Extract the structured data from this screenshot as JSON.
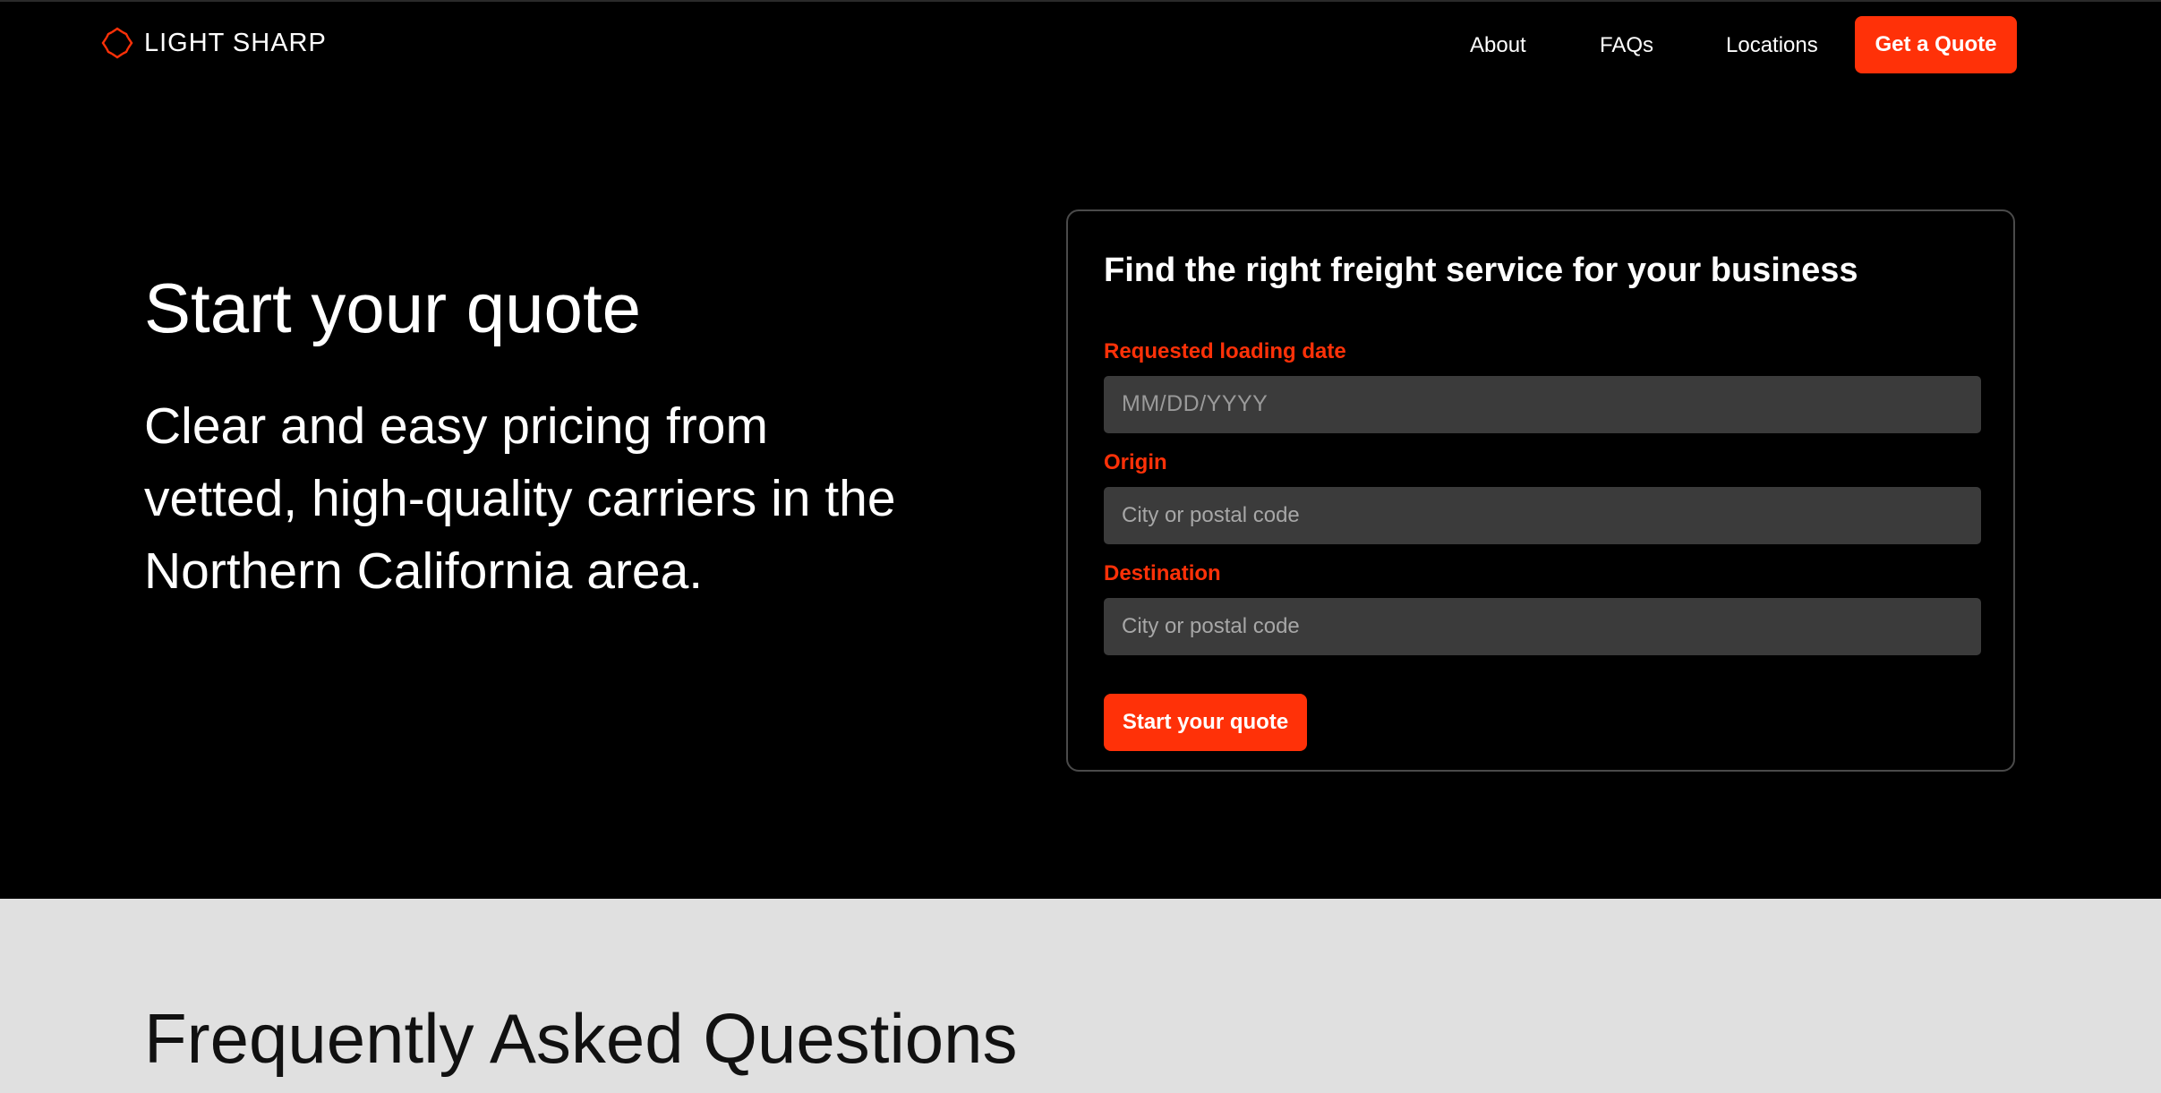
{
  "brand": {
    "name": "LIGHT SHARP",
    "logo_icon": "burst-logo-icon",
    "accent_color": "#ff3108"
  },
  "nav": {
    "about": "About",
    "faqs": "FAQs",
    "locations": "Locations",
    "cta": "Get a Quote"
  },
  "hero": {
    "title": "Start your quote",
    "subtitle": "Clear and easy pricing from vetted, high-quality carriers in the Northern California area."
  },
  "form": {
    "title": "Find the right freight service for your business",
    "date_label": "Requested loading date",
    "date_placeholder": "MM/DD/YYYY",
    "origin_label": "Origin",
    "origin_placeholder": "City or postal code",
    "destination_label": "Destination",
    "destination_placeholder": "City or postal code",
    "submit_label": "Start your quote"
  },
  "faq": {
    "title": "Frequently Asked Questions"
  }
}
